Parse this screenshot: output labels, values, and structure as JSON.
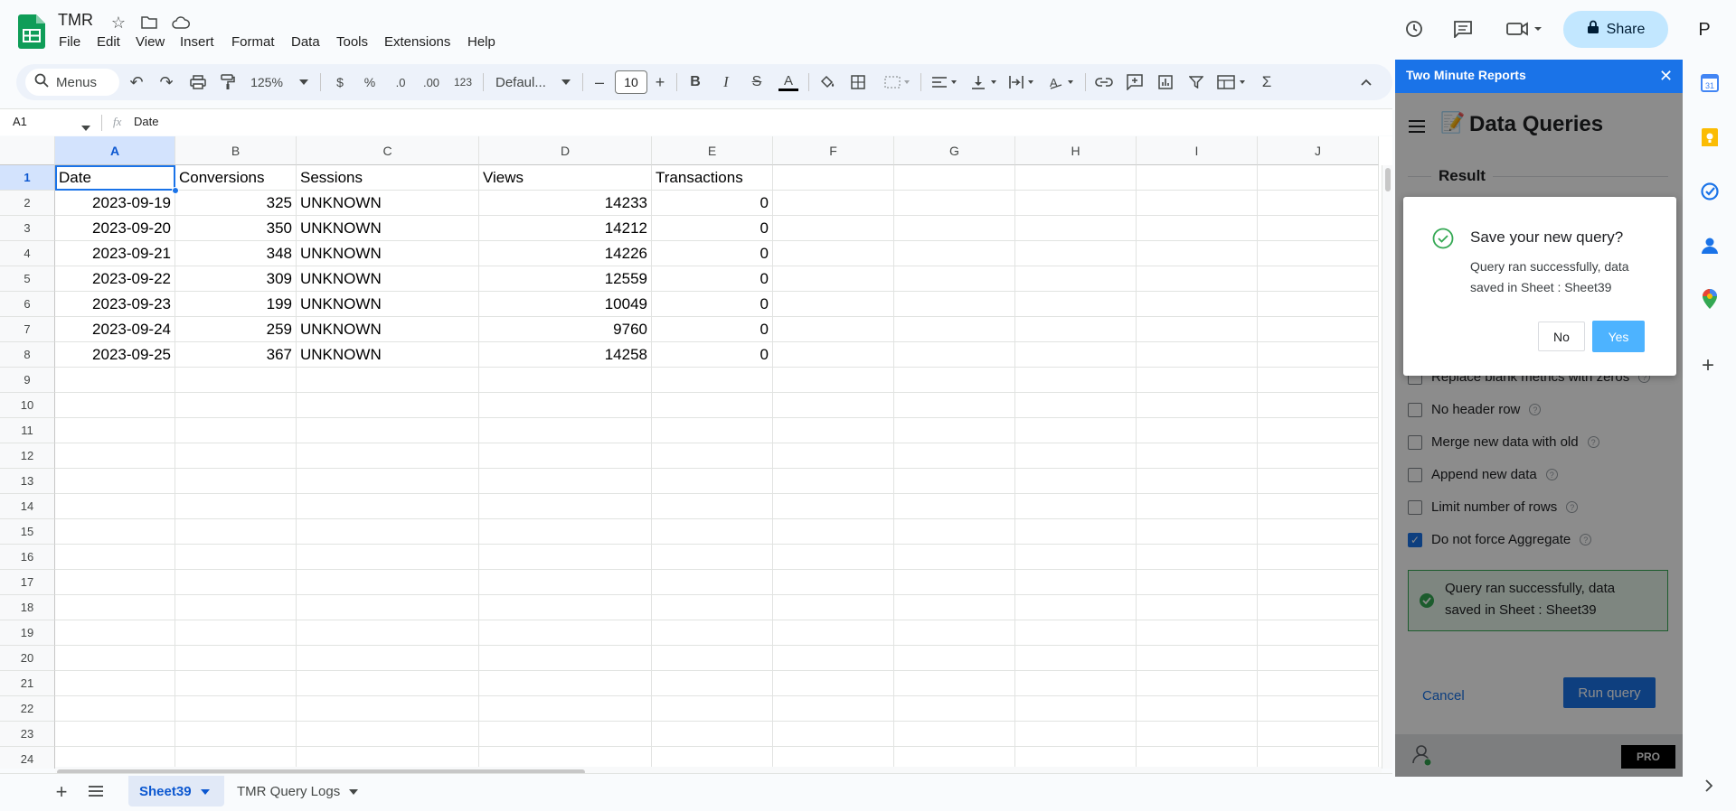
{
  "app": {
    "title": "TMR",
    "account_initial": "P",
    "share_label": "Share"
  },
  "menu": [
    "File",
    "Edit",
    "View",
    "Insert",
    "Format",
    "Data",
    "Tools",
    "Extensions",
    "Help"
  ],
  "toolbar": {
    "search_label": "Menus",
    "zoom": "125%",
    "currency": "$",
    "percent": "%",
    "dec_decrease": ".0",
    "dec_increase": ".00",
    "format_123": "123",
    "font": "Defaul...",
    "font_size": "10",
    "minus": "–",
    "plus": "+"
  },
  "formula_bar": {
    "cell_ref": "A1",
    "fx": "fx",
    "value": "Date"
  },
  "columns": [
    "A",
    "B",
    "C",
    "D",
    "E",
    "F",
    "G",
    "H",
    "I",
    "J"
  ],
  "rows": [
    "1",
    "2",
    "3",
    "4",
    "5",
    "6",
    "7",
    "8",
    "9",
    "10",
    "11",
    "12",
    "13",
    "14",
    "15",
    "16",
    "17",
    "18",
    "19",
    "20",
    "21",
    "22",
    "23",
    "24"
  ],
  "table": {
    "headers": [
      "Date",
      "Conversions",
      "Sessions",
      "Views",
      "Transactions"
    ],
    "data": [
      [
        "2023-09-19",
        "325",
        "UNKNOWN",
        "14233",
        "0"
      ],
      [
        "2023-09-20",
        "350",
        "UNKNOWN",
        "14212",
        "0"
      ],
      [
        "2023-09-21",
        "348",
        "UNKNOWN",
        "14226",
        "0"
      ],
      [
        "2023-09-22",
        "309",
        "UNKNOWN",
        "12559",
        "0"
      ],
      [
        "2023-09-23",
        "199",
        "UNKNOWN",
        "10049",
        "0"
      ],
      [
        "2023-09-24",
        "259",
        "UNKNOWN",
        "9760",
        "0"
      ],
      [
        "2023-09-25",
        "367",
        "UNKNOWN",
        "14258",
        "0"
      ]
    ]
  },
  "tabs": {
    "add": "+",
    "sheets": [
      {
        "label": "Sheet39",
        "active": true
      },
      {
        "label": "TMR Query Logs",
        "active": false
      }
    ]
  },
  "panel": {
    "header": "Two Minute Reports",
    "title": "Data Queries",
    "section": "Result",
    "options": [
      {
        "label": "Replace blank metrics with zeros",
        "checked": false
      },
      {
        "label": "No header row",
        "checked": false
      },
      {
        "label": "Merge new data with old",
        "checked": false
      },
      {
        "label": "Append new data",
        "checked": false
      },
      {
        "label": "Limit number of rows",
        "checked": false
      },
      {
        "label": "Do not force Aggregate",
        "checked": true
      }
    ],
    "success_line1": "Query ran successfully, data",
    "success_line2": "saved in Sheet : Sheet39",
    "cancel": "Cancel",
    "run": "Run query",
    "badge": "PRO"
  },
  "dialog": {
    "title": "Save your new query?",
    "line1": "Query ran successfully, data",
    "line2": "saved in Sheet : Sheet39",
    "no": "No",
    "yes": "Yes"
  },
  "colors": {
    "accent": "#1a73e8",
    "sheets_green": "#0f9d58",
    "yes_blue": "#4db3ff",
    "success_green": "#34a853"
  }
}
